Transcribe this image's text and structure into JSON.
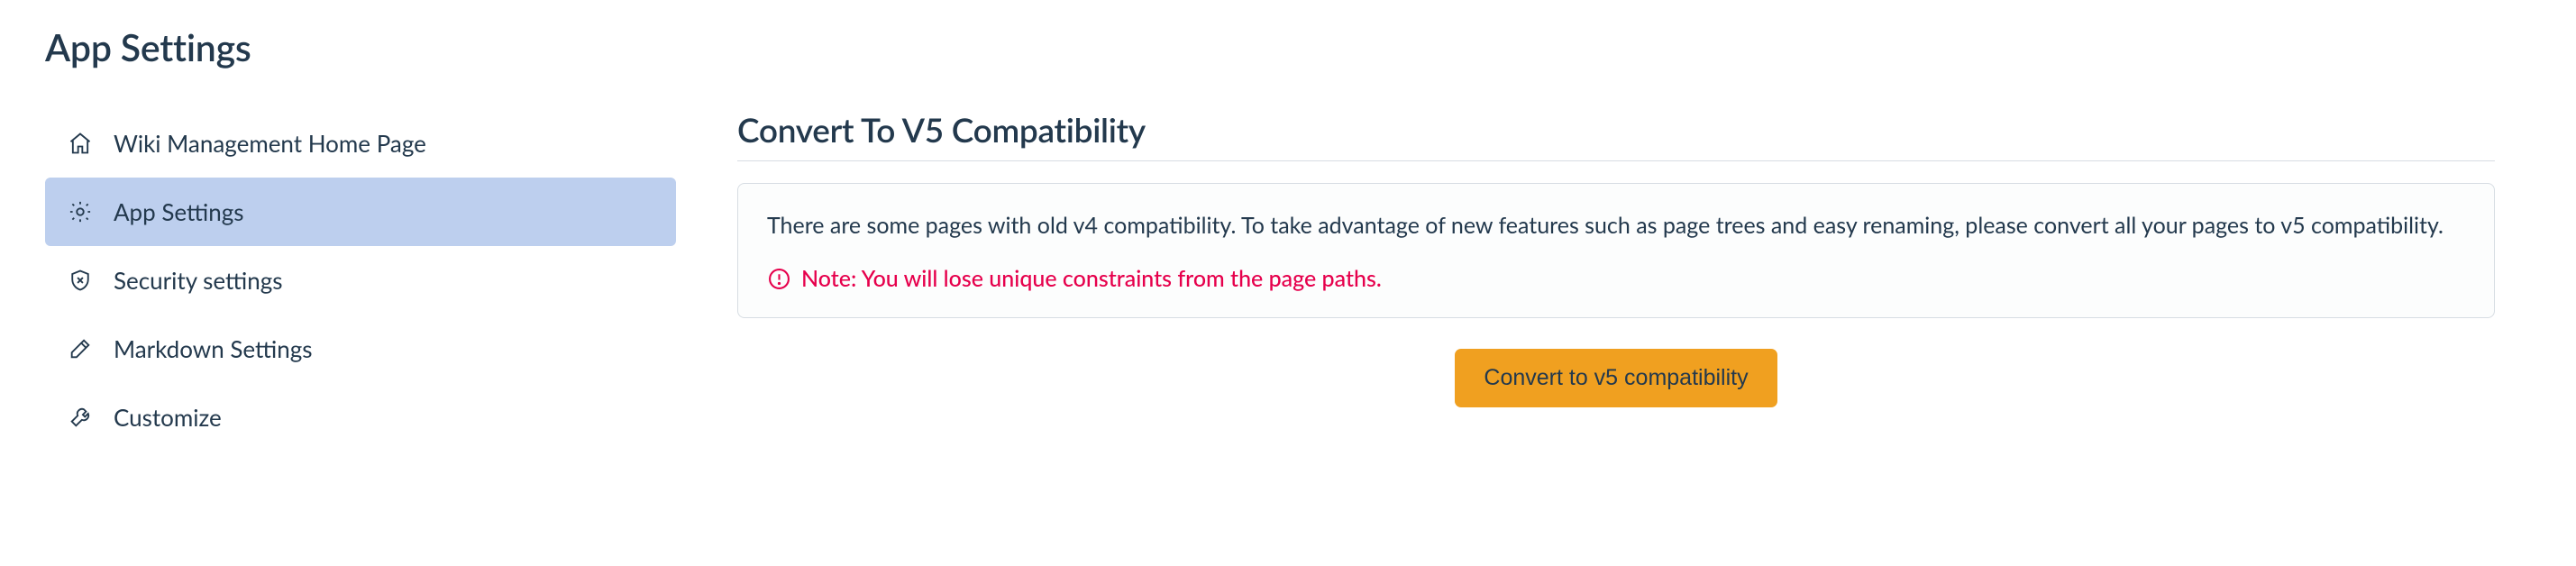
{
  "page_title": "App Settings",
  "sidebar": {
    "items": [
      {
        "label": "Wiki Management Home Page",
        "icon": "home-icon",
        "active": false
      },
      {
        "label": "App Settings",
        "icon": "gear-icon",
        "active": true
      },
      {
        "label": "Security settings",
        "icon": "shield-icon",
        "active": false
      },
      {
        "label": "Markdown Settings",
        "icon": "edit-icon",
        "active": false
      },
      {
        "label": "Customize",
        "icon": "wrench-icon",
        "active": false
      }
    ]
  },
  "section": {
    "title": "Convert To V5 Compatibility",
    "info_text": "There are some pages with old v4 compatibility. To take advantage of new features such as page trees and easy renaming, please convert all your pages to v5 compatibility.",
    "note_text": "Note: You will lose unique constraints from the page paths.",
    "button_label": "Convert to v5 compatibility"
  },
  "colors": {
    "accent_orange": "#f0a020",
    "danger_pink": "#e6004c",
    "sidebar_active_bg": "#bdcfee",
    "text_primary": "#23394d"
  }
}
